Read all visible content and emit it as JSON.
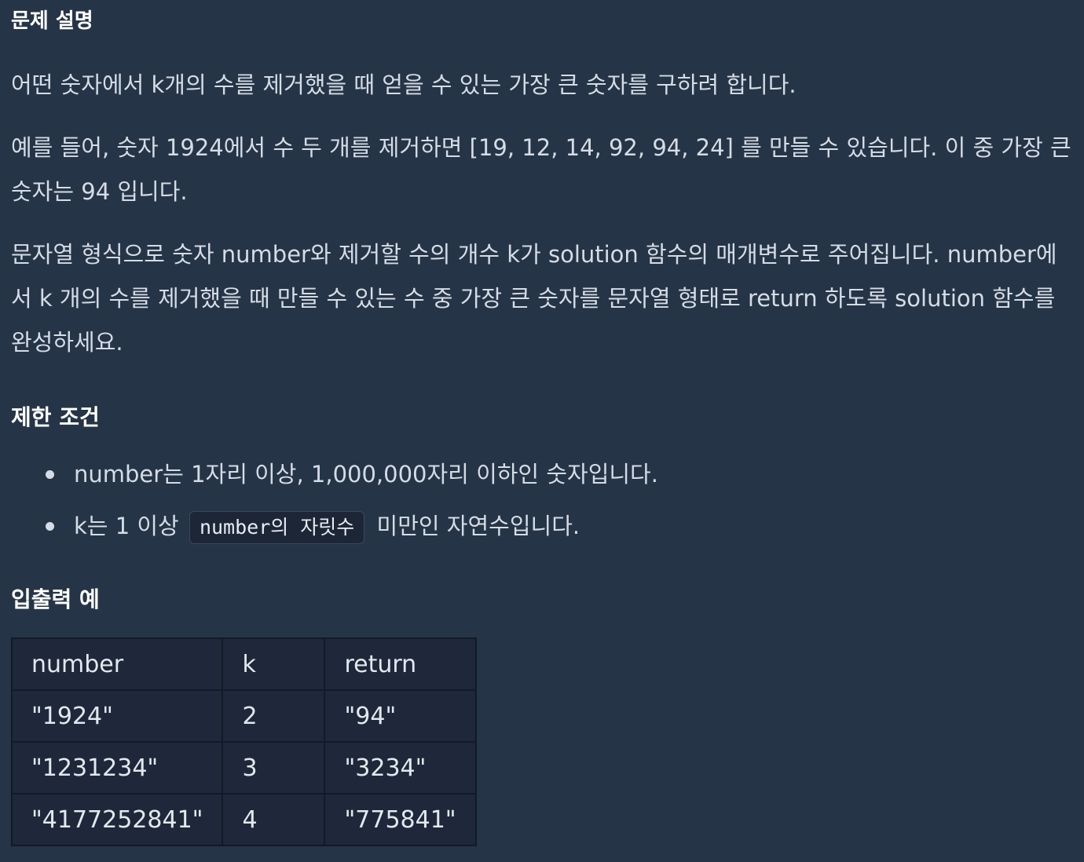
{
  "title": "문제 설명",
  "description": {
    "p1": "어떤 숫자에서 k개의 수를 제거했을 때 얻을 수 있는 가장 큰 숫자를 구하려 합니다.",
    "p2": "예를 들어, 숫자 1924에서 수 두 개를 제거하면 [19, 12, 14, 92, 94, 24] 를 만들 수 있습니다. 이 중 가장 큰 숫자는 94 입니다.",
    "p3": "문자열 형식으로 숫자 number와 제거할 수의 개수 k가 solution 함수의 매개변수로 주어집니다. number에서 k 개의 수를 제거했을 때 만들 수 있는 수 중 가장 큰 숫자를 문자열 형태로 return 하도록 solution 함수를 완성하세요."
  },
  "limits": {
    "heading": "제한 조건",
    "item1": "number는 1자리 이상, 1,000,000자리 이하인 숫자입니다.",
    "item2_before": "k는 1 이상",
    "item2_code": "number의 자릿수",
    "item2_after": "미만인 자연수입니다."
  },
  "examples": {
    "heading": "입출력 예",
    "headers": [
      "number",
      "k",
      "return"
    ],
    "rows": [
      [
        "\"1924\"",
        "2",
        "\"94\""
      ],
      [
        "\"1231234\"",
        "3",
        "\"3234\""
      ],
      [
        "\"4177252841\"",
        "4",
        "\"775841\""
      ]
    ]
  }
}
